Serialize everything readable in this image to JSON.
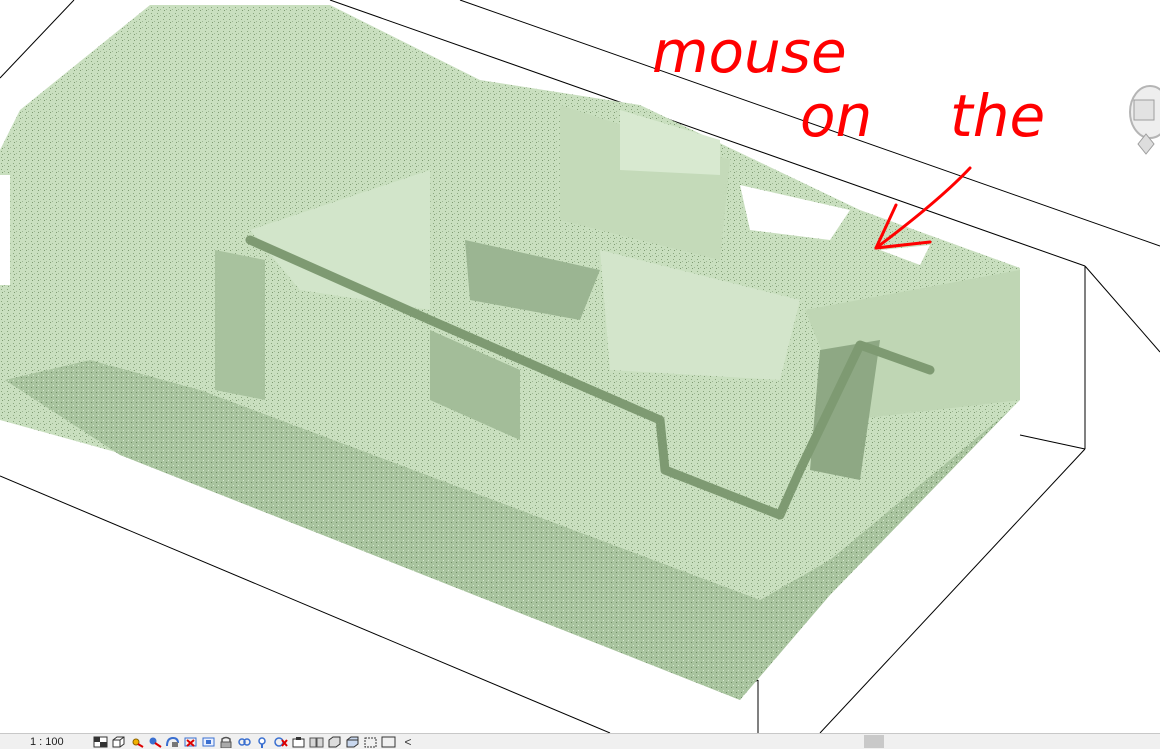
{
  "viewport": {
    "model": "point-cloud-3d-view",
    "point_color": "#c9dfbf",
    "shadow_color": "#8aa67e",
    "section_box_color": "#000000"
  },
  "annotation": {
    "line1": "mouse",
    "line2": "on",
    "line3": "the",
    "color": "#ff0000"
  },
  "view_cube": {
    "icon": "view-cube-icon"
  },
  "status_bar": {
    "scale": "1 : 100",
    "collapse_glyph": "<",
    "icons": [
      "detail-level-icon",
      "visual-style-icon",
      "sun-path-icon",
      "shadows-icon",
      "rendering-icon",
      "crop-view-icon",
      "show-crop-region-icon",
      "unlock-3d-view-icon",
      "temporary-hide-icon",
      "reveal-hidden-icon",
      "temporary-view-properties-icon",
      "worksharing-display-icon",
      "analytical-model-icon",
      "highlight-displacement-icon",
      "reveal-constraints-icon",
      "crop-box-icon",
      "section-box-icon"
    ]
  }
}
